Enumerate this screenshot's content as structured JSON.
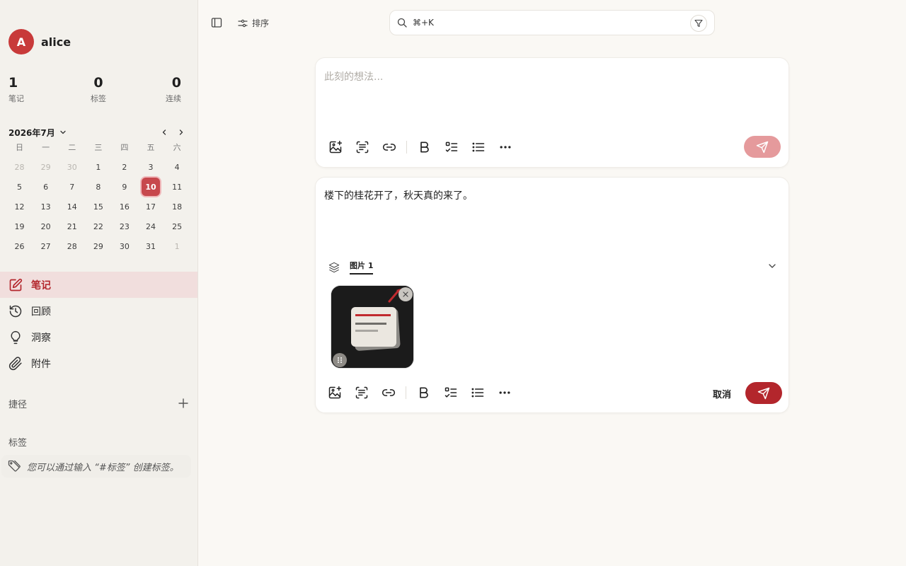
{
  "user": {
    "initial": "A",
    "name": "alice"
  },
  "stats": [
    {
      "value": "1",
      "label": "笔记"
    },
    {
      "value": "0",
      "label": "标签"
    },
    {
      "value": "0",
      "label": "连续"
    }
  ],
  "calendar": {
    "month_label": "2026年7月",
    "weekdays": [
      "日",
      "一",
      "二",
      "三",
      "四",
      "五",
      "六"
    ],
    "weeks": [
      [
        "28",
        "29",
        "30",
        "1",
        "2",
        "3",
        "4"
      ],
      [
        "5",
        "6",
        "7",
        "8",
        "9",
        "10",
        "11"
      ],
      [
        "12",
        "13",
        "14",
        "15",
        "16",
        "17",
        "18"
      ],
      [
        "19",
        "20",
        "21",
        "22",
        "23",
        "24",
        "25"
      ],
      [
        "26",
        "27",
        "28",
        "29",
        "30",
        "31",
        "1"
      ]
    ],
    "today": "10"
  },
  "nav": {
    "items": [
      {
        "label": "笔记",
        "icon": "edit-icon"
      },
      {
        "label": "回顾",
        "icon": "history-icon"
      },
      {
        "label": "洞察",
        "icon": "lightbulb-icon"
      },
      {
        "label": "附件",
        "icon": "paperclip-icon"
      }
    ]
  },
  "shortcuts": {
    "title": "捷径"
  },
  "tags": {
    "title": "标签",
    "hint": "您可以通过输入 “#标签” 创建标签。"
  },
  "topbar": {
    "sort_label": "排序",
    "search_placeholder": "⌘+K"
  },
  "composer": {
    "placeholder": "此刻的想法..."
  },
  "note": {
    "text": "楼下的桂花开了，秋天真的来了。",
    "attachment_tab": "图片 1",
    "cancel_label": "取消"
  },
  "colors": {
    "accent": "#b3262c",
    "accent_disabled": "#e59a9c",
    "avatar": "#c83a3a",
    "active_nav_bg": "#f1dedd",
    "sidebar_bg": "#f3f1ec",
    "main_bg": "#faf8f4"
  }
}
